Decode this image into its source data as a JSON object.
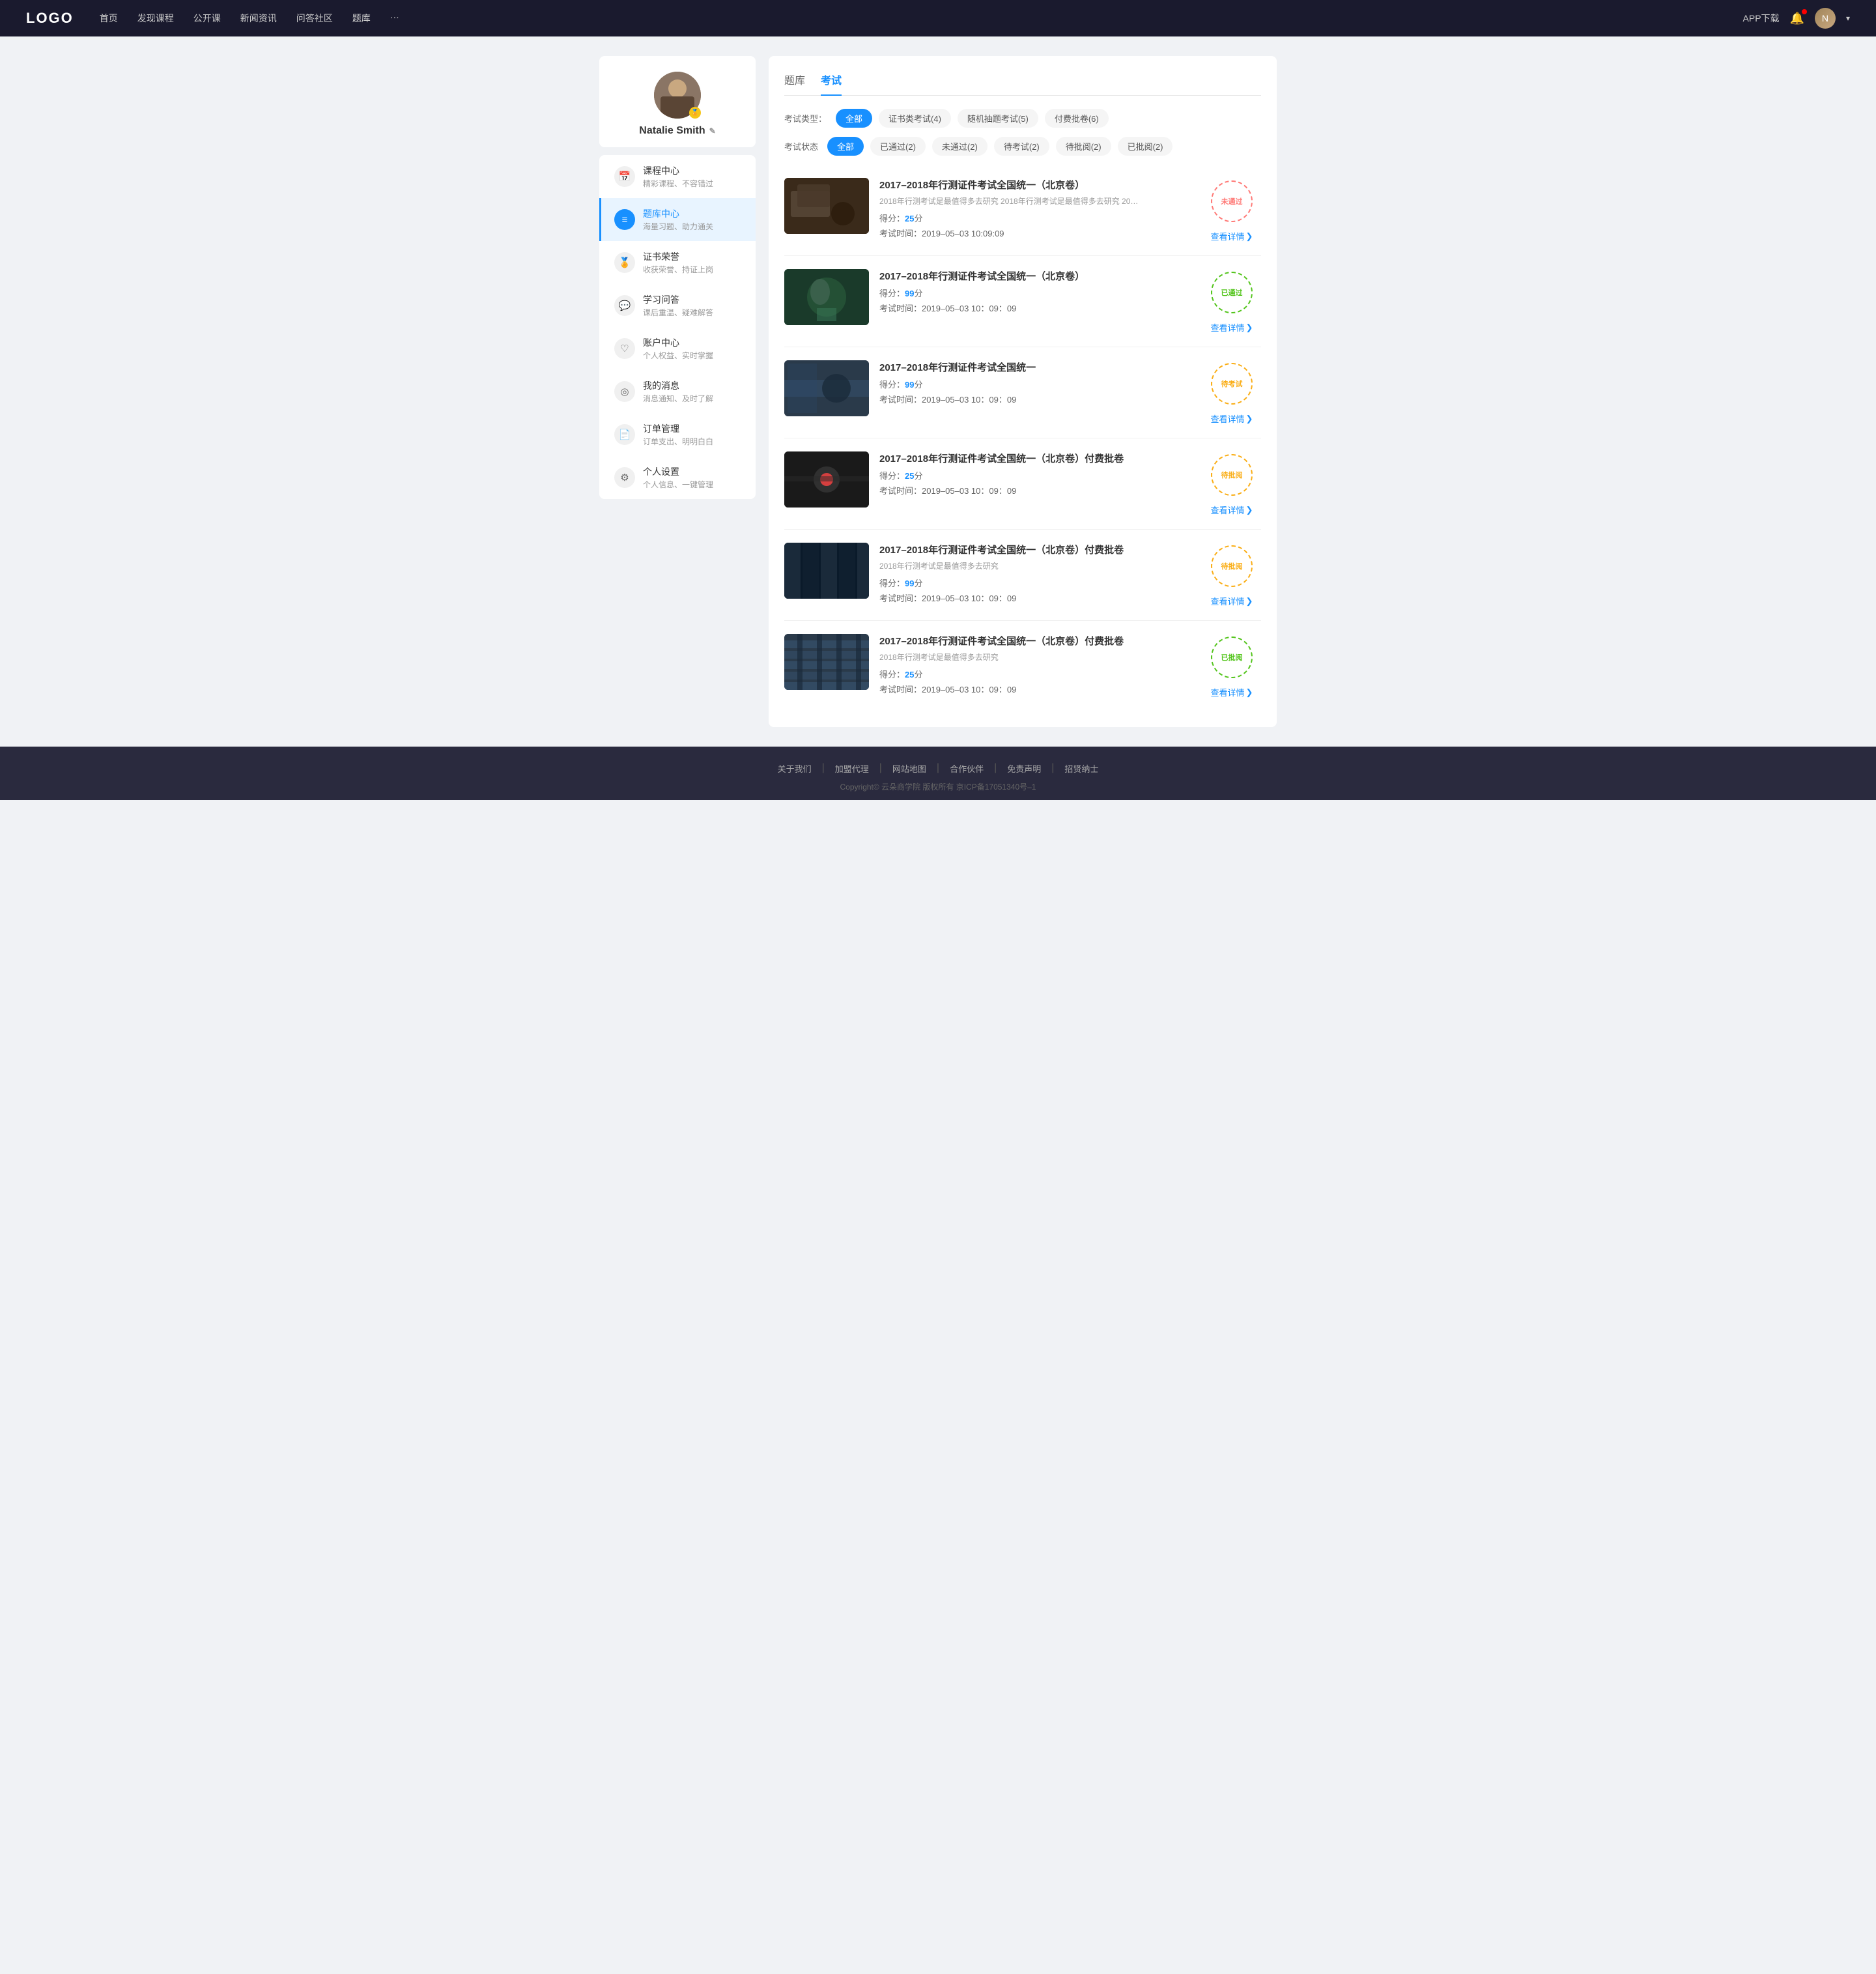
{
  "logo": "LOGO",
  "nav": {
    "items": [
      "首页",
      "发现课程",
      "公开课",
      "新闻资讯",
      "问答社区",
      "题库",
      "···"
    ],
    "right": {
      "appDl": "APP下载",
      "userName": "Natalie Smith"
    }
  },
  "sidebar": {
    "profile": {
      "name": "Natalie Smith",
      "editIcon": "✎"
    },
    "menuItems": [
      {
        "id": "course-center",
        "label": "课程中心",
        "sub": "精彩课程、不容错过",
        "icon": "📅",
        "active": false
      },
      {
        "id": "question-bank",
        "label": "题库中心",
        "sub": "海量习题、助力通关",
        "icon": "≡",
        "active": true
      },
      {
        "id": "certificates",
        "label": "证书荣誉",
        "sub": "收获荣誉、持证上岗",
        "icon": "🏅",
        "active": false
      },
      {
        "id": "qa",
        "label": "学习问答",
        "sub": "课后重温、疑难解答",
        "icon": "💬",
        "active": false
      },
      {
        "id": "account",
        "label": "账户中心",
        "sub": "个人权益、实时掌握",
        "icon": "♡",
        "active": false
      },
      {
        "id": "messages",
        "label": "我的消息",
        "sub": "消息通知、及时了解",
        "icon": "◎",
        "active": false
      },
      {
        "id": "orders",
        "label": "订单管理",
        "sub": "订单支出、明明白白",
        "icon": "📄",
        "active": false
      },
      {
        "id": "settings",
        "label": "个人设置",
        "sub": "个人信息、一键管理",
        "icon": "⚙",
        "active": false
      }
    ]
  },
  "content": {
    "tabs": [
      {
        "id": "question-bank-tab",
        "label": "题库"
      },
      {
        "id": "exam-tab",
        "label": "考试"
      }
    ],
    "activeTab": "exam-tab",
    "examTypeLabel": "考试类型：",
    "examTypeFilters": [
      {
        "id": "all-type",
        "label": "全部",
        "active": true
      },
      {
        "id": "cert-type",
        "label": "证书类考试(4)",
        "active": false
      },
      {
        "id": "random-type",
        "label": "随机抽题考试(5)",
        "active": false
      },
      {
        "id": "paid-type",
        "label": "付费批卷(6)",
        "active": false
      }
    ],
    "examStatusLabel": "考试状态",
    "examStatusFilters": [
      {
        "id": "all-status",
        "label": "全部",
        "active": true
      },
      {
        "id": "passed-status",
        "label": "已通过(2)",
        "active": false
      },
      {
        "id": "failed-status",
        "label": "未通过(2)",
        "active": false
      },
      {
        "id": "pending-status",
        "label": "待考试(2)",
        "active": false
      },
      {
        "id": "pending-review",
        "label": "待批阅(2)",
        "active": false
      },
      {
        "id": "reviewed",
        "label": "已批阅(2)",
        "active": false
      }
    ],
    "exams": [
      {
        "id": "exam-1",
        "title": "2017–2018年行测证件考试全国统一（北京卷）",
        "desc": "2018年行测考试是最值得多去研究 2018年行测考试是最值得多去研究 2018年行...",
        "score": "得分：",
        "scoreVal": "25",
        "scoreUnit": "分",
        "timeLabel": "考试时间：",
        "time": "2019–05–03  10:09:09",
        "stamp": "未通过",
        "stampClass": "stamp-fail",
        "viewLabel": "查看详情",
        "thumbClass": "thumb-1"
      },
      {
        "id": "exam-2",
        "title": "2017–2018年行测证件考试全国统一（北京卷）",
        "desc": "",
        "score": "得分：",
        "scoreVal": "99",
        "scoreUnit": "分",
        "timeLabel": "考试时间：",
        "time": "2019–05–03  10：09：09",
        "stamp": "已通过",
        "stampClass": "stamp-pass",
        "viewLabel": "查看详情",
        "thumbClass": "thumb-2"
      },
      {
        "id": "exam-3",
        "title": "2017–2018年行测证件考试全国统一",
        "desc": "",
        "score": "得分：",
        "scoreVal": "99",
        "scoreUnit": "分",
        "timeLabel": "考试时间：",
        "time": "2019–05–03  10：09：09",
        "stamp": "待考试",
        "stampClass": "stamp-pending",
        "viewLabel": "查看详情",
        "thumbClass": "thumb-3"
      },
      {
        "id": "exam-4",
        "title": "2017–2018年行测证件考试全国统一（北京卷）付费批卷",
        "desc": "",
        "score": "得分：",
        "scoreVal": "25",
        "scoreUnit": "分",
        "timeLabel": "考试时间：",
        "time": "2019–05–03  10：09：09",
        "stamp": "待批阅",
        "stampClass": "stamp-review-pending",
        "viewLabel": "查看详情",
        "thumbClass": "thumb-4"
      },
      {
        "id": "exam-5",
        "title": "2017–2018年行测证件考试全国统一（北京卷）付费批卷",
        "desc": "2018年行测考试是最值得多去研究",
        "score": "得分：",
        "scoreVal": "99",
        "scoreUnit": "分",
        "timeLabel": "考试时间：",
        "time": "2019–05–03  10：09：09",
        "stamp": "待批阅",
        "stampClass": "stamp-review-pending",
        "viewLabel": "查看详情",
        "thumbClass": "thumb-5"
      },
      {
        "id": "exam-6",
        "title": "2017–2018年行测证件考试全国统一（北京卷）付费批卷",
        "desc": "2018年行测考试是最值得多去研究",
        "score": "得分：",
        "scoreVal": "25",
        "scoreUnit": "分",
        "timeLabel": "考试时间：",
        "time": "2019–05–03  10：09：09",
        "stamp": "已批阅",
        "stampClass": "stamp-reviewed",
        "viewLabel": "查看详情",
        "thumbClass": "thumb-6"
      }
    ]
  },
  "footer": {
    "links": [
      "关于我们",
      "加盟代理",
      "网站地图",
      "合作伙伴",
      "免责声明",
      "招贤纳士"
    ],
    "copyright": "Copyright©  云朵商学院  版权所有    京ICP备17051340号–1"
  }
}
